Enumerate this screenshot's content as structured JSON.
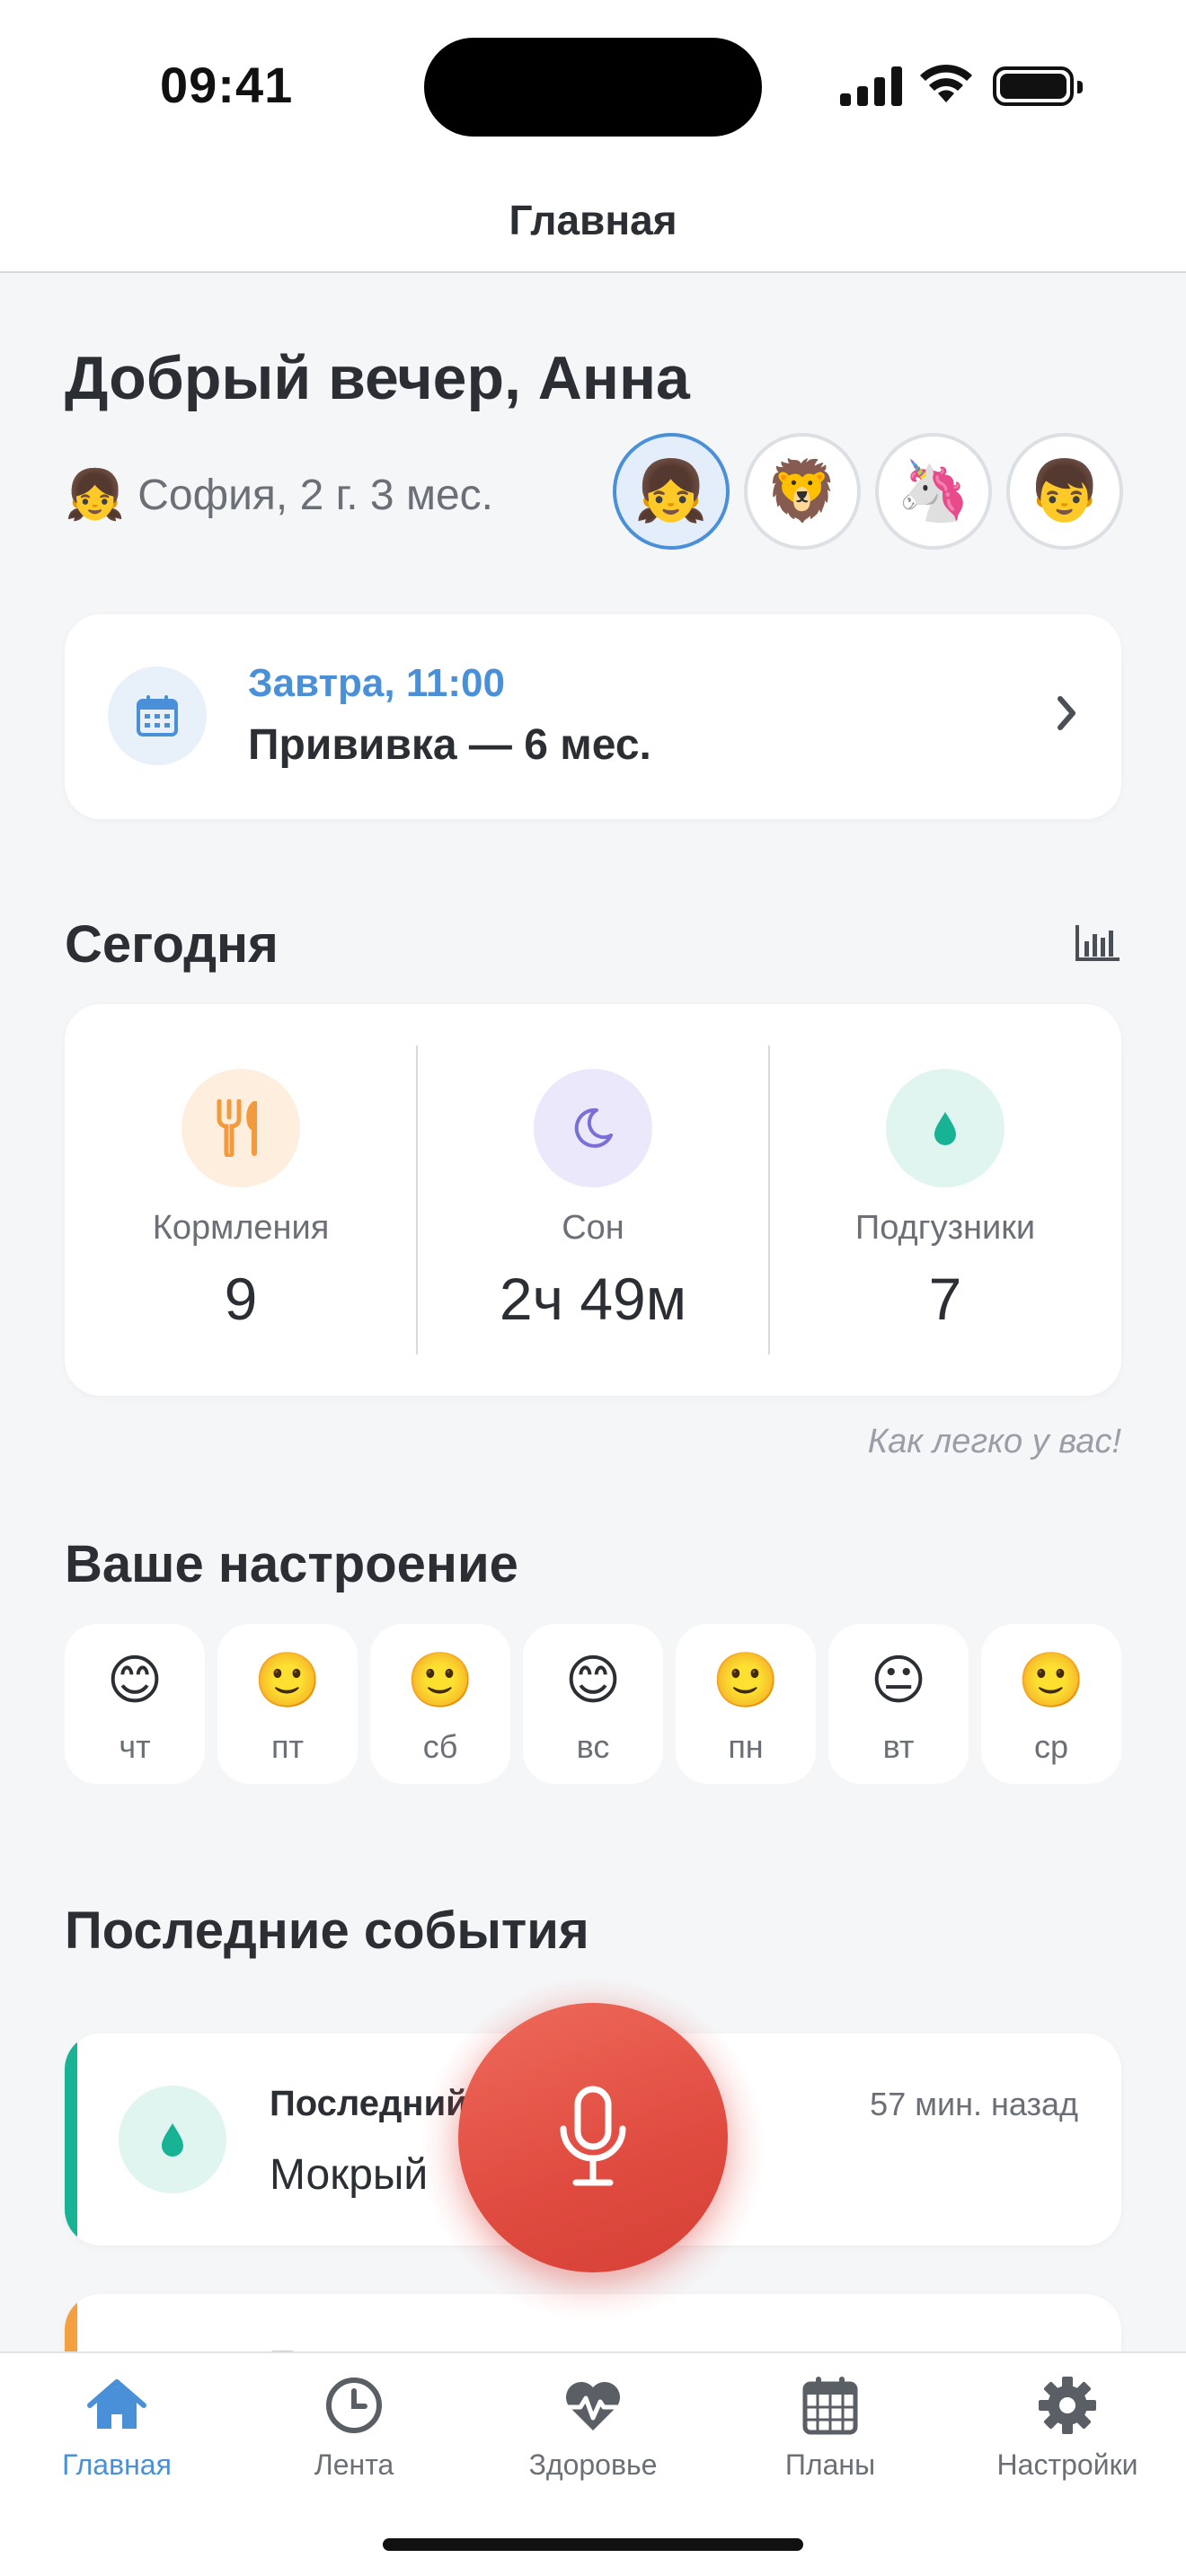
{
  "status_bar": {
    "time": "09:41"
  },
  "header": {
    "title": "Главная"
  },
  "greeting": "Добрый вечер, Анна",
  "child": {
    "emoji": "👧",
    "info": "София, 2 г. 3 мес."
  },
  "avatars": [
    {
      "emoji": "👧",
      "active": true
    },
    {
      "emoji": "🦁",
      "active": false
    },
    {
      "emoji": "🦄",
      "active": false
    },
    {
      "emoji": "👦",
      "active": false
    }
  ],
  "appointment": {
    "when": "Завтра, 11:00",
    "what": "Прививка — 6 мес."
  },
  "today": {
    "title": "Сегодня",
    "stats": [
      {
        "label": "Кормления",
        "value": "9",
        "icon": "fork-knife-icon",
        "color": "#f39a3e"
      },
      {
        "label": "Сон",
        "value": "2ч 49м",
        "icon": "moon-icon",
        "color": "#7a6fd6"
      },
      {
        "label": "Подгузники",
        "value": "7",
        "icon": "drop-icon",
        "color": "#18b394"
      }
    ],
    "note": "Как легко у вас!"
  },
  "mood": {
    "title": "Ваше настроение",
    "days": [
      {
        "emoji": "😊",
        "day": "чт"
      },
      {
        "emoji": "🙂",
        "day": "пт"
      },
      {
        "emoji": "🙂",
        "day": "сб"
      },
      {
        "emoji": "😊",
        "day": "вс"
      },
      {
        "emoji": "🙂",
        "day": "пн"
      },
      {
        "emoji": "😐",
        "day": "вт"
      },
      {
        "emoji": "🙂",
        "day": "ср"
      }
    ]
  },
  "events": {
    "title": "Последние события",
    "items": [
      {
        "title": "Последний",
        "value": "Мокрый",
        "time": "57 мин. назад",
        "icon": "drop-icon",
        "color": "#18b394"
      },
      {
        "title": "П",
        "value": "",
        "time": "",
        "icon": "fork-knife-icon",
        "color": "#f5a040"
      }
    ]
  },
  "tabs": [
    {
      "label": "Главная",
      "icon": "home-icon",
      "active": true
    },
    {
      "label": "Лента",
      "icon": "clock-icon",
      "active": false
    },
    {
      "label": "Здоровье",
      "icon": "heart-pulse-icon",
      "active": false
    },
    {
      "label": "Планы",
      "icon": "calendar-icon",
      "active": false
    },
    {
      "label": "Настройки",
      "icon": "gear-icon",
      "active": false
    }
  ],
  "colors": {
    "accent": "#4a90d9",
    "mic": "#e04b40",
    "background": "#f5f6f8"
  }
}
